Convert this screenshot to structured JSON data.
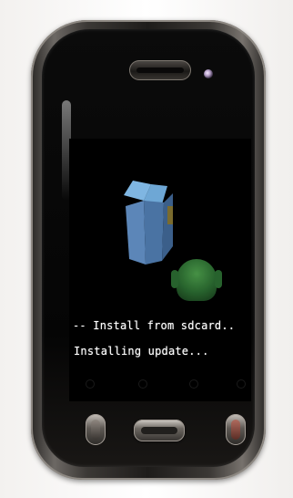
{
  "recovery_screen": {
    "line_install": "-- Install from sdcard..",
    "line_status": "Installing update..."
  },
  "colors": {
    "screen_text": "#ffffff",
    "box_blue": "#5c86b8",
    "robot_green": "#2b6b31"
  }
}
